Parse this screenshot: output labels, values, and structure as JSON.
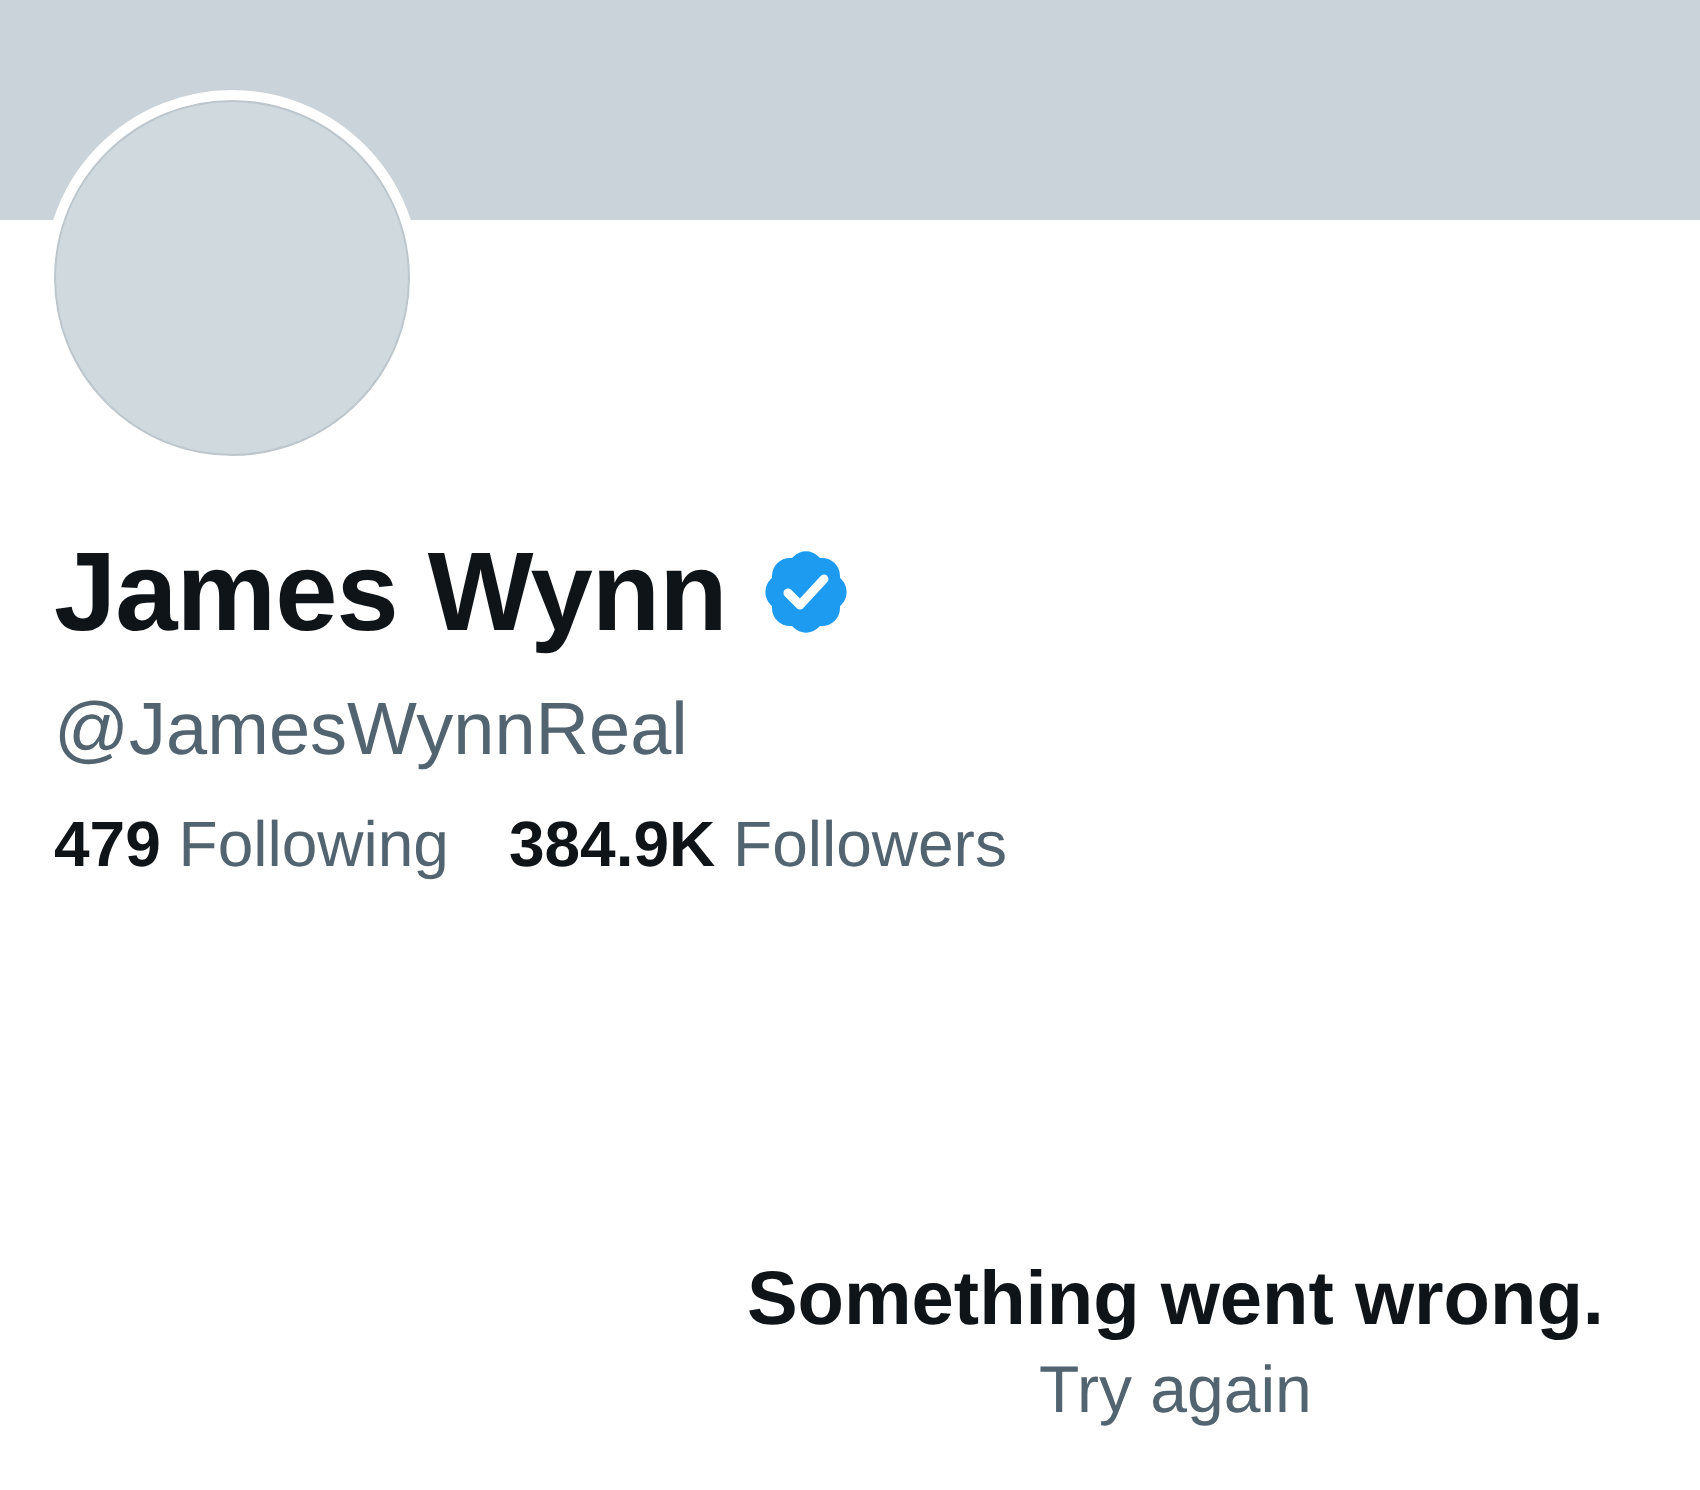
{
  "profile": {
    "name": "James Wynn",
    "verified": true,
    "handle": "@JamesWynnReal",
    "stats": [
      {
        "count": "479",
        "label": "Following"
      },
      {
        "count": "384.9K",
        "label": "Followers"
      }
    ]
  },
  "error": {
    "message": "Something went wrong.",
    "action": "Try again"
  }
}
